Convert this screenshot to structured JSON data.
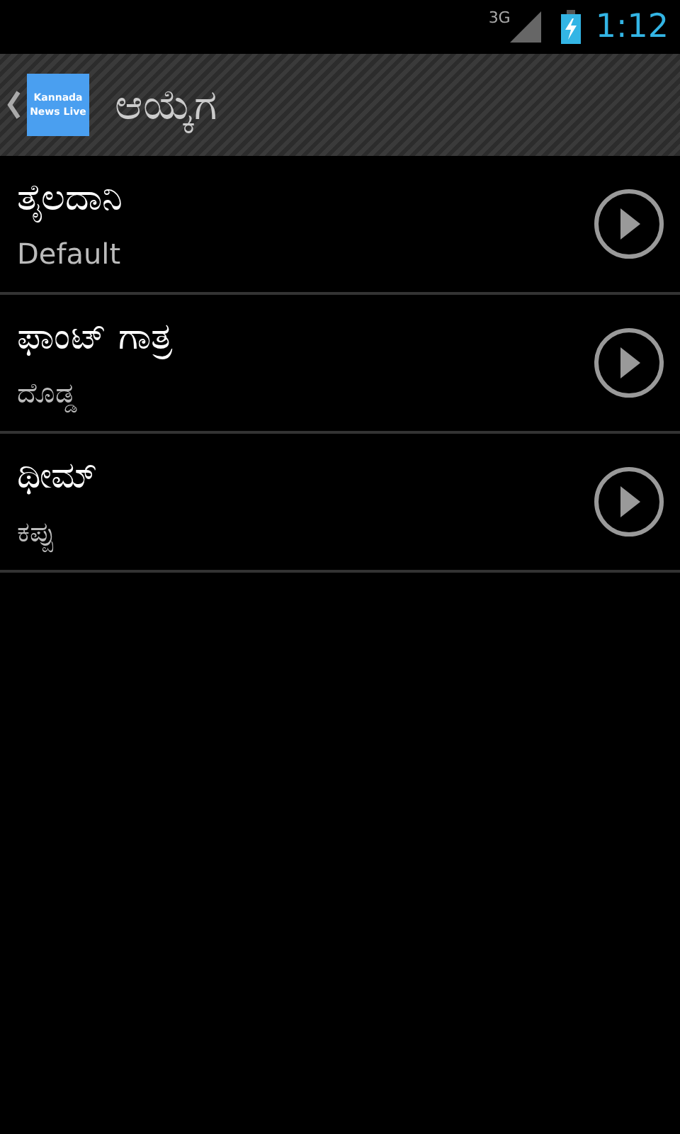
{
  "status_bar": {
    "network": "3G",
    "time": "1:12"
  },
  "action_bar": {
    "logo": [
      "Kannada",
      "News Live"
    ],
    "title": "ಆಯ್ಕೆಗ"
  },
  "settings": [
    {
      "title": "ತೈಲದಾನಿ",
      "summary": "Default"
    },
    {
      "title": "ಫಾಂಟ್ ಗಾತ್ರ",
      "summary": "ದೊಡ್ಡ"
    },
    {
      "title": "ಥೀಮ್",
      "summary": "ಕಪ್ಪು"
    }
  ]
}
